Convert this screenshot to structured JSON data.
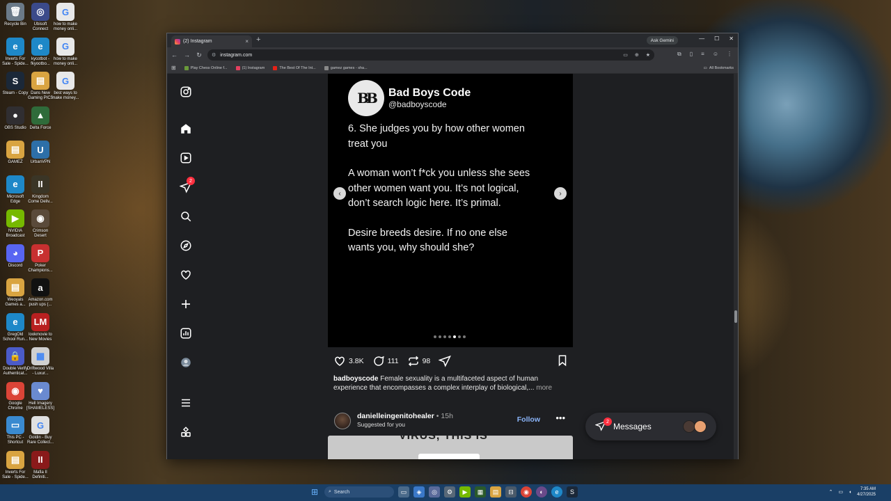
{
  "desktop": {
    "icons": [
      {
        "label": "Recycle Bin",
        "glyph": "🗑",
        "color": "#6b7a88"
      },
      {
        "label": "Ubisoft Connect",
        "glyph": "◎",
        "color": "#3b4a8a"
      },
      {
        "label": "how to make money onli...",
        "glyph": "G",
        "color": "#e8e8e8"
      },
      {
        "label": "Inverts For Sale - Spide...",
        "glyph": "e",
        "color": "#1e88c8"
      },
      {
        "label": "kycotbot - fkyootbo...",
        "glyph": "e",
        "color": "#1e88c8"
      },
      {
        "label": "how to make money onli...",
        "glyph": "G",
        "color": "#e8e8e8"
      },
      {
        "label": "Steam - Copy",
        "glyph": "S",
        "color": "#1b2838"
      },
      {
        "label": "Dans New Gaming PIC5",
        "glyph": "▤",
        "color": "#d9a441"
      },
      {
        "label": "best ways to make money...",
        "glyph": "G",
        "color": "#e8e8e8"
      },
      {
        "label": "OBS Studio",
        "glyph": "●",
        "color": "#302e31"
      },
      {
        "label": "Delta Force",
        "glyph": "▲",
        "color": "#2f6b3a"
      },
      {
        "label": "GAMEZ",
        "glyph": "▤",
        "color": "#d9a441"
      },
      {
        "label": "UrbanVPN",
        "glyph": "U",
        "color": "#2d6fa8"
      },
      {
        "label": "Microsoft Edge",
        "glyph": "e",
        "color": "#1e88c8"
      },
      {
        "label": "Kingdom Come Deliv...",
        "glyph": "II",
        "color": "#3a3526"
      },
      {
        "label": "NVIDIA Broadcast",
        "glyph": "▶",
        "color": "#76b900"
      },
      {
        "label": "Crimson Desert",
        "glyph": "◉",
        "color": "#5a4a3a"
      },
      {
        "label": "Discord",
        "glyph": "◕",
        "color": "#5865f2"
      },
      {
        "label": "Poker Champions...",
        "glyph": "P",
        "color": "#c83030"
      },
      {
        "label": "Weoyals Games a...",
        "glyph": "▤",
        "color": "#d9a441"
      },
      {
        "label": "Amazon.com push ups (...",
        "glyph": "a",
        "color": "#111111"
      },
      {
        "label": "GregOld School Run...",
        "glyph": "e",
        "color": "#1e88c8"
      },
      {
        "label": "lookmovie to New Movies",
        "glyph": "LM",
        "color": "#b82020"
      },
      {
        "label": "Double Verify Authenticat...",
        "glyph": "🔒",
        "color": "#4b5bc8"
      },
      {
        "label": "Driftwood Villa - Luxur...",
        "glyph": "▦",
        "color": "#d0d0d0"
      },
      {
        "label": "Google Chrome",
        "glyph": "◉",
        "color": "#db4437"
      },
      {
        "label": "Hell Imagery [SHAMELESS]",
        "glyph": "♥",
        "color": "#6a8ad0"
      },
      {
        "label": "This PC - Shortcut",
        "glyph": "▭",
        "color": "#3a8ad0"
      },
      {
        "label": "Goldin - Buy Rare Collect...",
        "glyph": "G",
        "color": "#e0e0e0"
      },
      {
        "label": "Inverts For Sale - Spide...",
        "glyph": "▤",
        "color": "#d9a441"
      },
      {
        "label": "Mafia II Definiti...",
        "glyph": "II",
        "color": "#8a1a1a"
      }
    ]
  },
  "browser": {
    "tab_title": "(2) Instagram",
    "tab_close": "×",
    "new_tab": "+",
    "ask_gemini": "Ask Gemini",
    "url": "instagram.com",
    "bookmarks": [
      {
        "label": "Play Chess Online f...",
        "color": "#6a9a3a"
      },
      {
        "label": "(1) Instagram",
        "color": "#e4405f"
      },
      {
        "label": "The Best Of The Int...",
        "color": "#e62117"
      },
      {
        "label": "gamez games - sha...",
        "color": "#888888"
      }
    ],
    "all_bookmarks": "All Bookmarks"
  },
  "instagram": {
    "notification_count": "2",
    "post": {
      "account_name": "Bad Boys Code",
      "account_handle": "@badboyscode",
      "logo_text": "BB",
      "paragraphs": [
        "6. She judges you by how other women treat you",
        "A woman won’t f*ck you unless she sees other women want you. It’s not logical, don’t search logic here. It’s primal.",
        "Desire breeds desire. If no one else wants you, why should she?"
      ],
      "slide_count": 7,
      "active_slide": 5,
      "likes": "3.8K",
      "comments": "111",
      "reposts": "98",
      "caption_user": "badboyscode",
      "caption_text": "Female sexuality is a multifaceted aspect of human experience that encompasses a complex interplay of biological,...",
      "caption_more": "more"
    },
    "suggested": {
      "username": "danielleingenitohealer",
      "time": "• 15h",
      "subtitle": "Suggested for you",
      "follow": "Follow",
      "next_post_text": "VIRUS, THIS IS"
    },
    "messages": {
      "label": "Messages",
      "count": "2"
    }
  },
  "taskbar": {
    "search": "Search",
    "clock_time": "7:35 AM",
    "clock_date": "4/27/2025"
  }
}
